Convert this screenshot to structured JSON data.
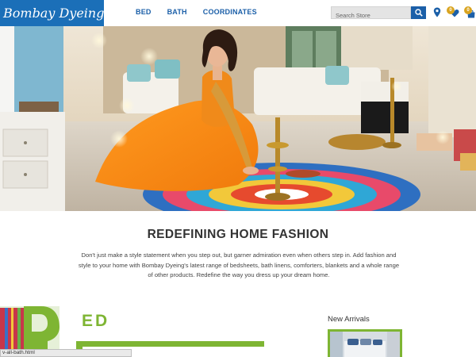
{
  "header": {
    "logo_text": "Bombay Dyeing",
    "nav": [
      {
        "label": "BED"
      },
      {
        "label": "BATH"
      },
      {
        "label": "COORDINATES"
      }
    ],
    "search_placeholder": "Search Store",
    "wishlist_count": "0",
    "cart_count": "0"
  },
  "hero": {
    "slide_count": 6,
    "active_slide": 6
  },
  "main": {
    "headline": "REDEFINING HOME FASHION",
    "description": "Don't just make a style statement when you step out, but garner admiration even when others step in. Add fashion and style to your home with Bombay Dyeing's latest range of bedsheets, bath linens, comforters, blankets and a whole range of other products. Redefine the way you dress up your dream home."
  },
  "categories": {
    "bed_title": "ED"
  },
  "new_arrivals": {
    "title": "New Arrivals"
  },
  "status_bar": {
    "url": "v-all-bath.html"
  },
  "colors": {
    "brand_blue": "#1b6fb8",
    "accent_green": "#7eb533",
    "badge_gold": "#d9a420"
  }
}
